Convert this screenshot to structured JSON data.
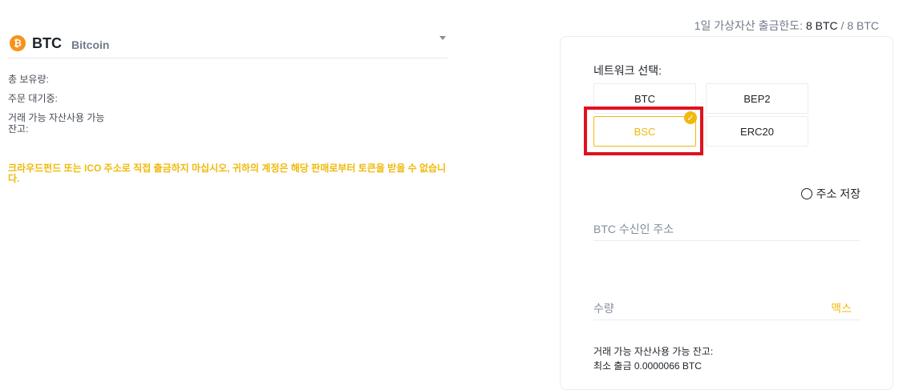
{
  "coin": {
    "logo_glyph": "₿",
    "symbol": "BTC",
    "name": "Bitcoin",
    "color": "#f7931a"
  },
  "info": {
    "total_holdings": "총 보유량:",
    "pending_orders": "주문 대기중:",
    "available_balance": "거래 가능 자산사용 가능 잔고:"
  },
  "warning": "크라우드펀드 또는 ICO 주소로 직접 출금하지 마십시오, 귀하의 계정은 해당 판매로부터 토큰을 받을 수 없습니다.",
  "limit": {
    "label": "1일 가상자산 출금한도: ",
    "used": "8 BTC",
    "separator": " / ",
    "total": "8 BTC"
  },
  "network": {
    "label": "네트워크 선택:",
    "options": [
      {
        "label": "BTC",
        "selected": false
      },
      {
        "label": "BEP2",
        "selected": false
      },
      {
        "label": "BSC",
        "selected": true
      },
      {
        "label": "ERC20",
        "selected": false
      }
    ],
    "check_glyph": "✓"
  },
  "save_address": {
    "label": "주소 저장"
  },
  "recipient": {
    "label": "BTC 수신인 주소"
  },
  "amount": {
    "label": "수량",
    "max_label": "맥스"
  },
  "bottom": {
    "available": "거래 가능 자산사용 가능 잔고:",
    "min_withdraw": "최소 출금 0.0000066 BTC"
  },
  "colors": {
    "accent": "#f0b90b",
    "highlight": "#e0121f"
  }
}
